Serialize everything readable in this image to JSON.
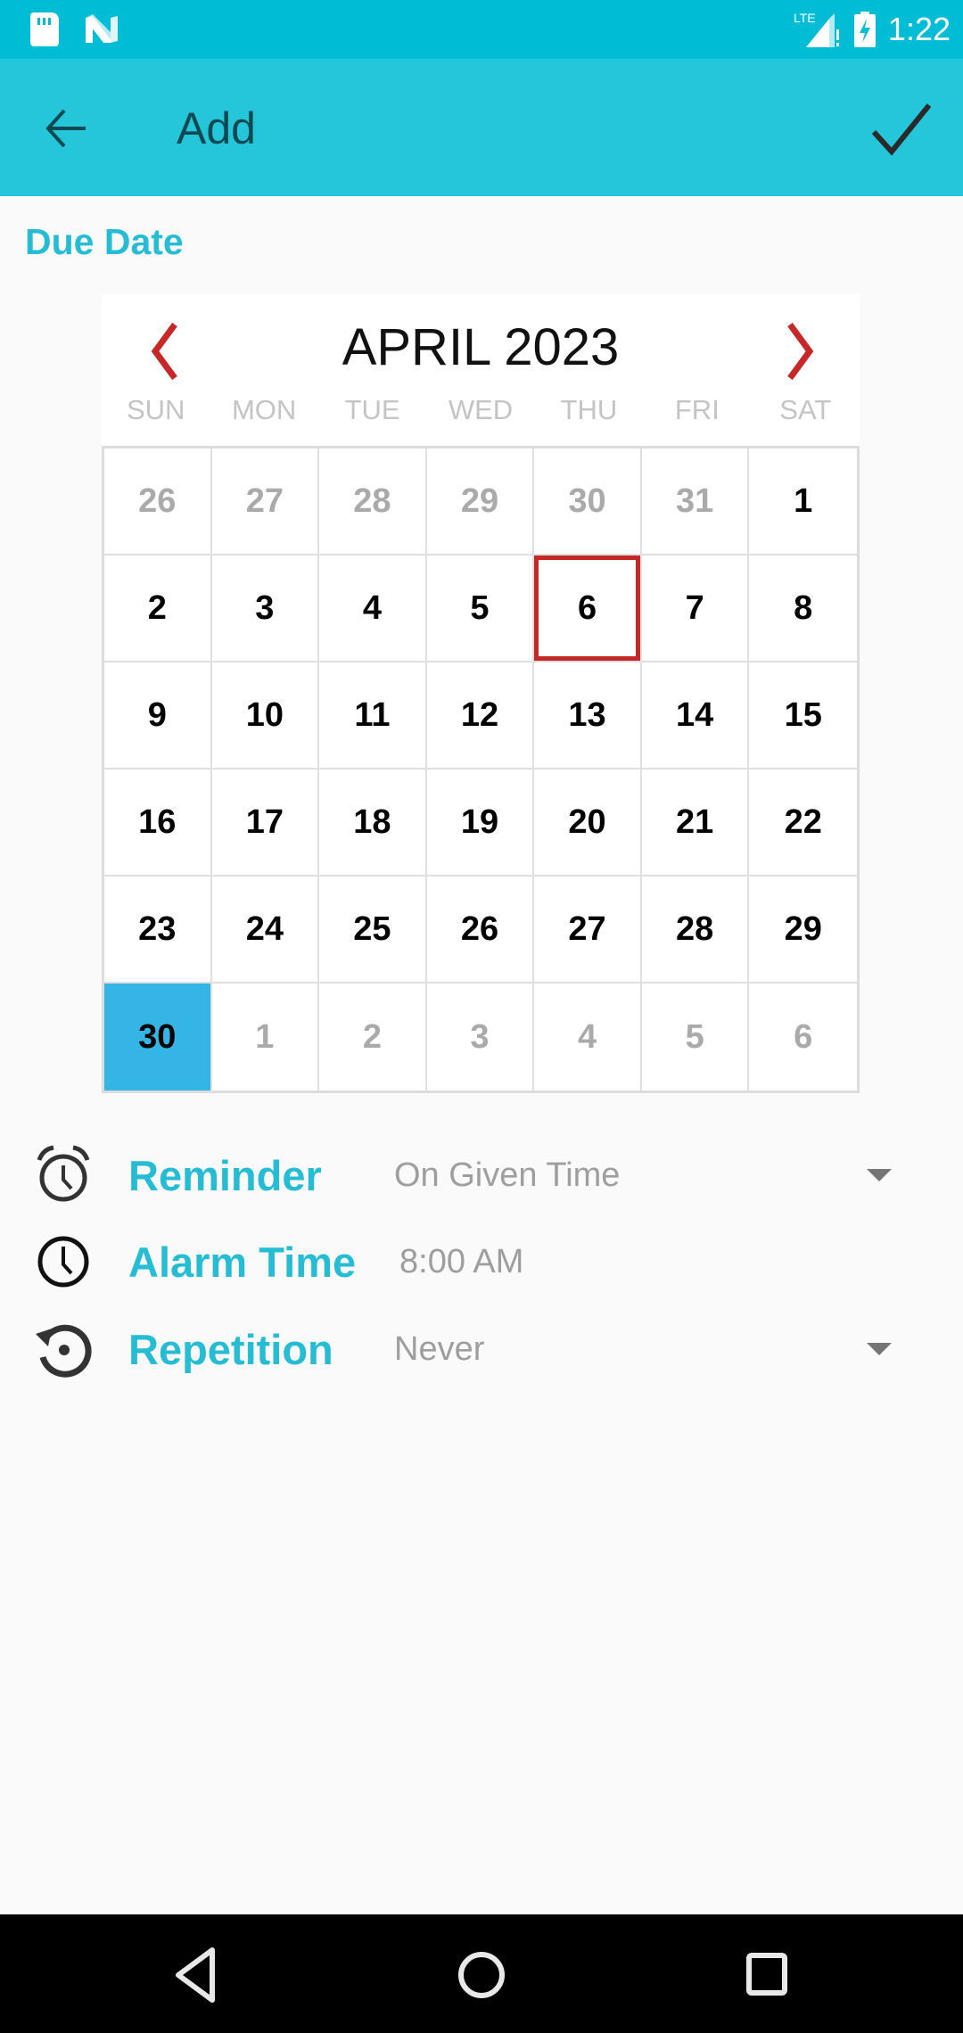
{
  "status_bar": {
    "time": "1:22",
    "icons": [
      "sd-card-icon",
      "n-logo-icon",
      "lte-signal-icon",
      "battery-charging-icon"
    ],
    "network_label": "LTE"
  },
  "toolbar": {
    "title": "Add",
    "back_icon": "arrow-left-icon",
    "confirm_icon": "check-icon"
  },
  "due_date": {
    "label": "Due Date"
  },
  "calendar": {
    "month_label": "APRIL 2023",
    "prev_icon": "chevron-left-icon",
    "next_icon": "chevron-right-icon",
    "weekdays": [
      "SUN",
      "MON",
      "TUE",
      "WED",
      "THU",
      "FRI",
      "SAT"
    ],
    "days": [
      {
        "d": "26",
        "m": "other"
      },
      {
        "d": "27",
        "m": "other"
      },
      {
        "d": "28",
        "m": "other"
      },
      {
        "d": "29",
        "m": "other"
      },
      {
        "d": "30",
        "m": "other"
      },
      {
        "d": "31",
        "m": "other"
      },
      {
        "d": "1",
        "m": "cur"
      },
      {
        "d": "2",
        "m": "cur"
      },
      {
        "d": "3",
        "m": "cur"
      },
      {
        "d": "4",
        "m": "cur"
      },
      {
        "d": "5",
        "m": "cur"
      },
      {
        "d": "6",
        "m": "cur",
        "today": true
      },
      {
        "d": "7",
        "m": "cur"
      },
      {
        "d": "8",
        "m": "cur"
      },
      {
        "d": "9",
        "m": "cur"
      },
      {
        "d": "10",
        "m": "cur"
      },
      {
        "d": "11",
        "m": "cur"
      },
      {
        "d": "12",
        "m": "cur"
      },
      {
        "d": "13",
        "m": "cur"
      },
      {
        "d": "14",
        "m": "cur"
      },
      {
        "d": "15",
        "m": "cur"
      },
      {
        "d": "16",
        "m": "cur"
      },
      {
        "d": "17",
        "m": "cur"
      },
      {
        "d": "18",
        "m": "cur"
      },
      {
        "d": "19",
        "m": "cur"
      },
      {
        "d": "20",
        "m": "cur"
      },
      {
        "d": "21",
        "m": "cur"
      },
      {
        "d": "22",
        "m": "cur"
      },
      {
        "d": "23",
        "m": "cur"
      },
      {
        "d": "24",
        "m": "cur"
      },
      {
        "d": "25",
        "m": "cur"
      },
      {
        "d": "26",
        "m": "cur"
      },
      {
        "d": "27",
        "m": "cur"
      },
      {
        "d": "28",
        "m": "cur"
      },
      {
        "d": "29",
        "m": "cur"
      },
      {
        "d": "30",
        "m": "cur",
        "selected": true
      },
      {
        "d": "1",
        "m": "other"
      },
      {
        "d": "2",
        "m": "other"
      },
      {
        "d": "3",
        "m": "other"
      },
      {
        "d": "4",
        "m": "other"
      },
      {
        "d": "5",
        "m": "other"
      },
      {
        "d": "6",
        "m": "other"
      }
    ],
    "today": "6",
    "selected": "30",
    "colors": {
      "today_border": "#c62828",
      "selected_bg": "#35b5e6",
      "nav_arrows": "#c62828"
    }
  },
  "settings": {
    "reminder": {
      "label": "Reminder",
      "value": "On Given Time",
      "icon": "alarm-clock-icon"
    },
    "alarm_time": {
      "label": "Alarm Time",
      "value": "8:00 AM",
      "icon": "clock-icon"
    },
    "repetition": {
      "label": "Repetition",
      "value": "Never",
      "icon": "repeat-icon"
    }
  },
  "nav_bar": {
    "buttons": [
      "back-icon",
      "home-icon",
      "recents-icon"
    ]
  },
  "colors": {
    "status_bar": "#00bcd4",
    "toolbar": "#26c6da",
    "accent": "#26bcd4",
    "background": "#fafafa"
  }
}
